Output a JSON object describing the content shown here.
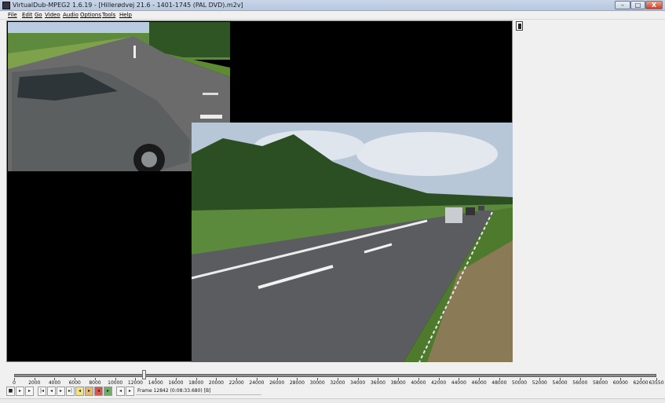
{
  "window": {
    "title": "VirtualDub-MPEG2 1.6.19 - [Hillerødvej 21.6 - 1401-1745 (PAL DVD).m2v]",
    "minimize_glyph": "–",
    "maximize_glyph": "□",
    "close_glyph": "X"
  },
  "menu": [
    "File",
    "Edit",
    "Go",
    "Video",
    "Audio",
    "Options",
    "Tools",
    "Help"
  ],
  "video": {
    "input_pane": "video frame: road with grey car in foreground",
    "output_pane": "video frame: two-lane road with distant vehicles and trees"
  },
  "timeline": {
    "max_frame": 63550,
    "current_frame": 12842,
    "tick_labels": [
      "0",
      "2000",
      "4000",
      "6000",
      "8000",
      "10000",
      "12000",
      "14000",
      "16000",
      "18000",
      "20000",
      "22000",
      "24000",
      "26000",
      "28000",
      "30000",
      "32000",
      "34000",
      "36000",
      "38000",
      "40000",
      "42000",
      "44000",
      "46000",
      "48000",
      "50000",
      "52000",
      "54000",
      "56000",
      "58000",
      "60000",
      "62000",
      "63550"
    ]
  },
  "toolbar": {
    "buttons": [
      "stop-icon",
      "play-input-icon",
      "play-output-icon",
      "go-start-icon",
      "prev-frame-icon",
      "next-frame-icon",
      "go-end-icon",
      "prev-keyframe-icon",
      "next-keyframe-icon",
      "prev-scene-icon",
      "next-scene-icon",
      "mark-in-icon",
      "mark-out-icon"
    ],
    "frame_label": "Frame 12842 (0:08:33.680) [B]"
  }
}
